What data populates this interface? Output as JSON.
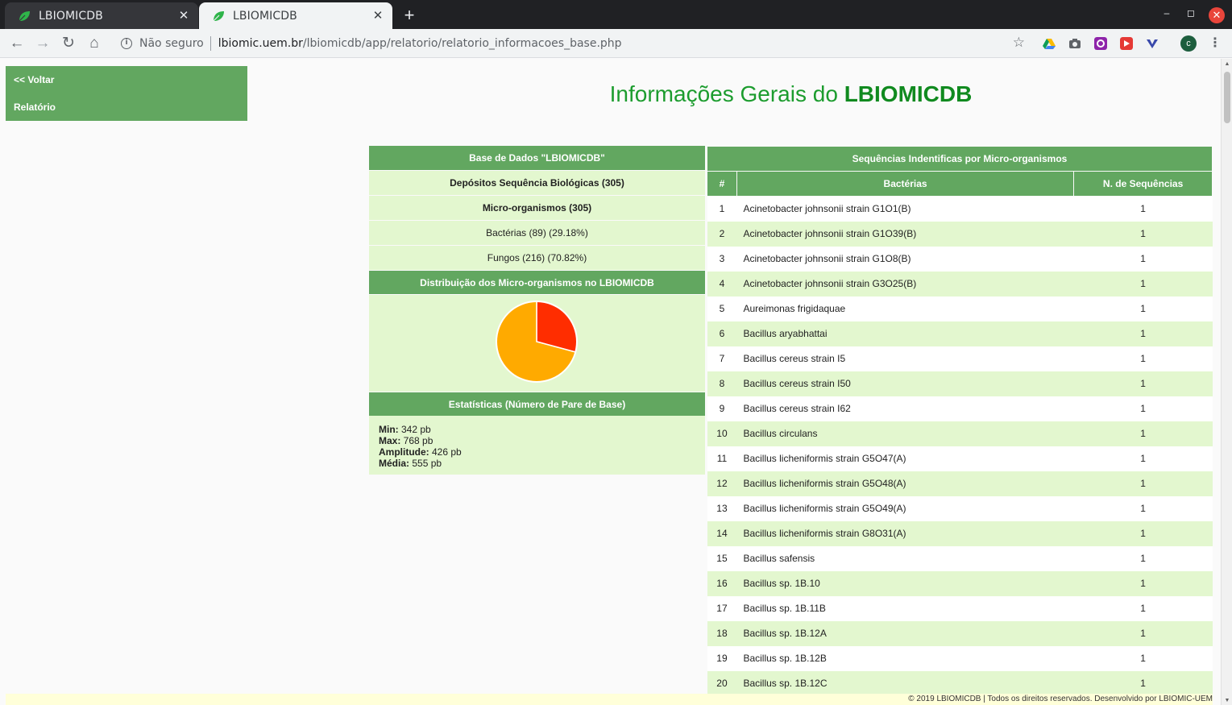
{
  "browser": {
    "tabs": [
      {
        "title": "LBIOMICDB",
        "active": false
      },
      {
        "title": "LBIOMICDB",
        "active": true
      }
    ],
    "new_tab": "+",
    "not_secure": "Não seguro",
    "url_host": "lbiomic.uem.br",
    "url_path": "/lbiomicdb/app/relatorio/relatorio_informacoes_base.php",
    "profile_initial": "c"
  },
  "sidebar": {
    "back_label": "<< Voltar",
    "report_label": "Relatório"
  },
  "page": {
    "title_prefix": "Informações Gerais do ",
    "title_brand": "LBIOMICDB"
  },
  "summary": {
    "db_header": "Base de Dados \"LBIOMICDB\"",
    "deposits": "Depósitos Sequência Biológicas (305)",
    "microorganisms": "Micro-organismos (305)",
    "bacteria": "Bactérias (89) (29.18%)",
    "fungi": "Fungos (216) (70.82%)",
    "distribution_header": "Distribuição dos Micro-organismos no LBIOMICDB",
    "stats_header": "Estatísticas (Número de Pare de Base)",
    "stats": [
      {
        "label": "Min:",
        "value": " 342 pb"
      },
      {
        "label": "Max:",
        "value": " 768 pb"
      },
      {
        "label": "Amplitude:",
        "value": " 426 pb"
      },
      {
        "label": "Média:",
        "value": " 555 pb"
      }
    ]
  },
  "chart_data": {
    "type": "pie",
    "categories": [
      "Bactérias",
      "Fungos"
    ],
    "values": [
      89,
      216
    ],
    "colors": [
      "#ff2d00",
      "#ffaa00"
    ]
  },
  "sequences": {
    "header": "Sequências Indentificas por Micro-organismos",
    "columns": [
      "#",
      "Bactérias",
      "N. de Sequências"
    ],
    "rows": [
      [
        "1",
        "Acinetobacter johnsonii strain G1O1(B)",
        "1"
      ],
      [
        "2",
        "Acinetobacter johnsonii strain G1O39(B)",
        "1"
      ],
      [
        "3",
        "Acinetobacter johnsonii strain G1O8(B)",
        "1"
      ],
      [
        "4",
        "Acinetobacter johnsonii strain G3O25(B)",
        "1"
      ],
      [
        "5",
        "Aureimonas frigidaquae",
        "1"
      ],
      [
        "6",
        "Bacillus aryabhattai",
        "1"
      ],
      [
        "7",
        "Bacillus cereus strain I5",
        "1"
      ],
      [
        "8",
        "Bacillus cereus strain I50",
        "1"
      ],
      [
        "9",
        "Bacillus cereus strain I62",
        "1"
      ],
      [
        "10",
        "Bacillus circulans",
        "1"
      ],
      [
        "11",
        "Bacillus licheniformis strain G5O47(A)",
        "1"
      ],
      [
        "12",
        "Bacillus licheniformis strain G5O48(A)",
        "1"
      ],
      [
        "13",
        "Bacillus licheniformis strain G5O49(A)",
        "1"
      ],
      [
        "14",
        "Bacillus licheniformis strain G8O31(A)",
        "1"
      ],
      [
        "15",
        "Bacillus safensis",
        "1"
      ],
      [
        "16",
        "Bacillus sp. 1B.10",
        "1"
      ],
      [
        "17",
        "Bacillus sp. 1B.11B",
        "1"
      ],
      [
        "18",
        "Bacillus sp. 1B.12A",
        "1"
      ],
      [
        "19",
        "Bacillus sp. 1B.12B",
        "1"
      ],
      [
        "20",
        "Bacillus sp. 1B.12C",
        "1"
      ]
    ]
  },
  "footer": {
    "text": "© 2019 LBIOMICDB | Todos os direitos reservados. Desenvolvido por LBIOMIC-UEM"
  }
}
